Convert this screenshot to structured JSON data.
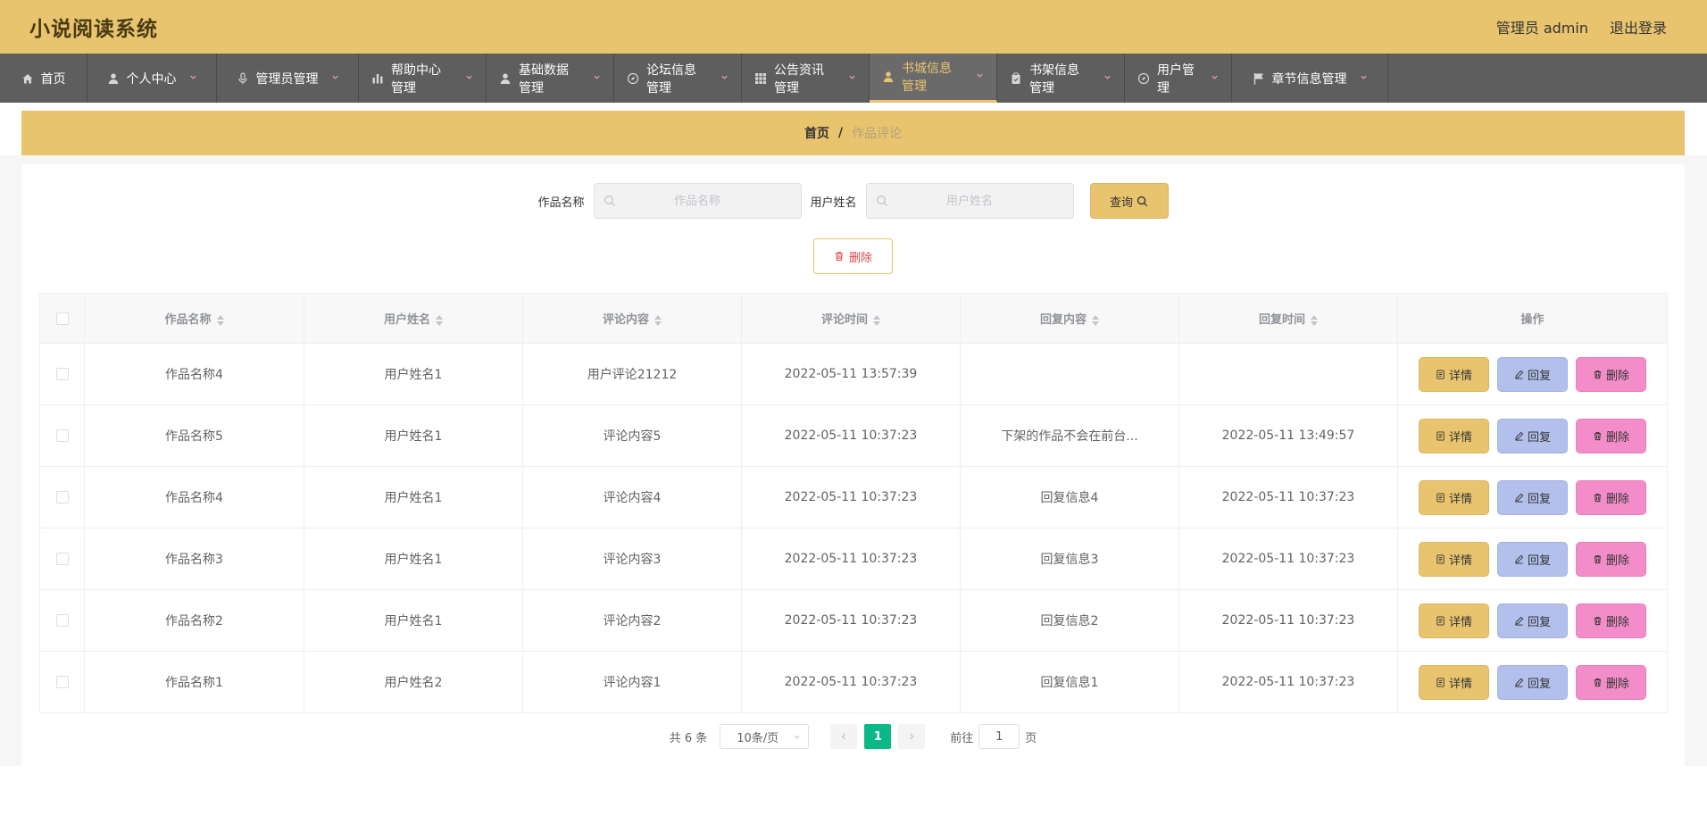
{
  "header": {
    "title": "小说阅读系统",
    "user_label": "管理员 admin",
    "logout_label": "退出登录"
  },
  "nav": {
    "items": [
      {
        "label": "首页",
        "icon": "home-icon",
        "has_chevron": false
      },
      {
        "label": "个人中心",
        "icon": "user-icon",
        "has_chevron": true
      },
      {
        "label": "管理员管理",
        "icon": "microphone-icon",
        "has_chevron": true
      },
      {
        "label": "帮助中心管理",
        "icon": "bar-chart-icon",
        "has_chevron": true
      },
      {
        "label": "基础数据管理",
        "icon": "user-icon",
        "has_chevron": true
      },
      {
        "label": "论坛信息管理",
        "icon": "compass-icon",
        "has_chevron": true
      },
      {
        "label": "公告资讯管理",
        "icon": "grid-icon",
        "has_chevron": true
      },
      {
        "label": "书城信息管理",
        "icon": "user-icon",
        "has_chevron": true,
        "active": true
      },
      {
        "label": "书架信息管理",
        "icon": "clipboard-icon",
        "has_chevron": true
      },
      {
        "label": "用户管理",
        "icon": "compass-icon",
        "has_chevron": true
      },
      {
        "label": "章节信息管理",
        "icon": "flag-icon",
        "has_chevron": true
      }
    ]
  },
  "breadcrumb": {
    "home": "首页",
    "separator": "/",
    "current": "作品评论"
  },
  "search": {
    "field1_label": "作品名称",
    "field1_placeholder": "作品名称",
    "field2_label": "用户姓名",
    "field2_placeholder": "用户姓名",
    "query_label": "查询"
  },
  "actions": {
    "delete_label": "删除"
  },
  "table": {
    "columns": [
      "作品名称",
      "用户姓名",
      "评论内容",
      "评论时间",
      "回复内容",
      "回复时间",
      "操作"
    ],
    "rows": [
      {
        "work": "作品名称4",
        "user": "用户姓名1",
        "comment": "用户评论21212",
        "comment_time": "2022-05-11 13:57:39",
        "reply": "",
        "reply_time": ""
      },
      {
        "work": "作品名称5",
        "user": "用户姓名1",
        "comment": "评论内容5",
        "comment_time": "2022-05-11 10:37:23",
        "reply": "下架的作品不会在前台...",
        "reply_time": "2022-05-11 13:49:57"
      },
      {
        "work": "作品名称4",
        "user": "用户姓名1",
        "comment": "评论内容4",
        "comment_time": "2022-05-11 10:37:23",
        "reply": "回复信息4",
        "reply_time": "2022-05-11 10:37:23"
      },
      {
        "work": "作品名称3",
        "user": "用户姓名1",
        "comment": "评论内容3",
        "comment_time": "2022-05-11 10:37:23",
        "reply": "回复信息3",
        "reply_time": "2022-05-11 10:37:23"
      },
      {
        "work": "作品名称2",
        "user": "用户姓名1",
        "comment": "评论内容2",
        "comment_time": "2022-05-11 10:37:23",
        "reply": "回复信息2",
        "reply_time": "2022-05-11 10:37:23"
      },
      {
        "work": "作品名称1",
        "user": "用户姓名2",
        "comment": "评论内容1",
        "comment_time": "2022-05-11 10:37:23",
        "reply": "回复信息1",
        "reply_time": "2022-05-11 10:37:23"
      }
    ],
    "op_detail": "详情",
    "op_reply": "回复",
    "op_delete": "删除"
  },
  "pagination": {
    "total": "共 6 条",
    "page_size": "10条/页",
    "current_page": "1",
    "goto_prefix": "前往",
    "goto_value": "1",
    "goto_suffix": "页"
  },
  "colors": {
    "brand": "#e8c46f",
    "nav_bg": "#5e5e5e",
    "reply_button": "#b3c0ec",
    "delete_button": "#f28dc9",
    "active_page": "#0bb986"
  }
}
